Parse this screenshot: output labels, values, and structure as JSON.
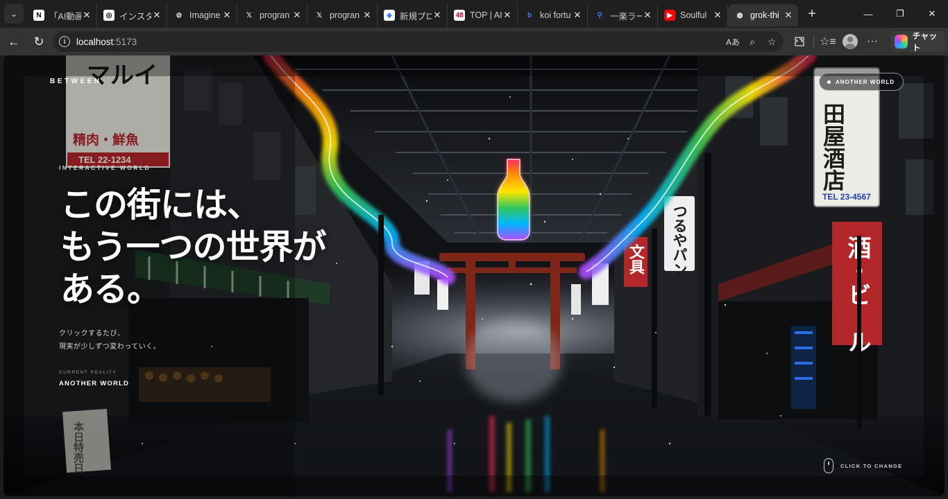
{
  "browser": {
    "tabs": [
      {
        "title": "「AI動画",
        "favicon": "notion-icon",
        "color": "#ffffff"
      },
      {
        "title": "インスタYo",
        "favicon": "chatgpt-icon",
        "color": "#ffffff"
      },
      {
        "title": "Imagine",
        "favicon": "grok-icon",
        "color": "#ffffff"
      },
      {
        "title": "progran",
        "favicon": "x-icon",
        "color": "#ffffff"
      },
      {
        "title": "progran",
        "favicon": "x-icon",
        "color": "#ffffff"
      },
      {
        "title": "新規プロ",
        "favicon": "gemini-icon",
        "color": "#ffffff"
      },
      {
        "title": "TOP | AI",
        "favicon": "site-48-icon",
        "color": "#ffffff"
      },
      {
        "title": "koi fortu",
        "favicon": "bing-icon",
        "color": "#ffffff"
      },
      {
        "title": "一楽ラー",
        "favicon": "search-icon",
        "color": "#ffffff"
      },
      {
        "title": "Soulful",
        "favicon": "youtube-icon",
        "color": "#ff0000"
      },
      {
        "title": "grok-thi",
        "favicon": "globe-icon",
        "color": "#ffffff"
      }
    ],
    "active_tab_index": 10,
    "address": {
      "host": "localhost",
      "port": ":5173"
    },
    "chat_label": "チャット"
  },
  "page": {
    "brand": "BETWEEN",
    "kicker": "INTERACTIVE WORLD",
    "headline_lines": [
      "この街には、",
      "もう一つの世界が",
      "ある。"
    ],
    "subcopy_lines": [
      "クリックするたび、",
      "現実が少しずつ変わっていく。"
    ],
    "reality_label": "CURRENT REALITY",
    "reality_value": "ANOTHER WORLD",
    "world_pill": "ANOTHER WORLD",
    "click_hint": "CLICK TO CHANGE"
  },
  "scene_signs": {
    "left_top_big": "マルイ",
    "left_top_small": "精肉・鮮魚",
    "left_tel": "TEL 22-1234",
    "right_top": "田屋酒店",
    "right_tel": "TEL 23-4567",
    "tsuruya": "つるやパン",
    "bungu": "文具",
    "sake_beer": "酒・ビール",
    "honjitsu": "本日特売日"
  },
  "colors": {
    "accent_rainbow": [
      "#ff2d55",
      "#ff9500",
      "#ffcc00",
      "#34c759",
      "#00c7ff",
      "#5856d6",
      "#af52de"
    ],
    "torii": "#8a2a1c",
    "sign_red": "#b3262a"
  }
}
